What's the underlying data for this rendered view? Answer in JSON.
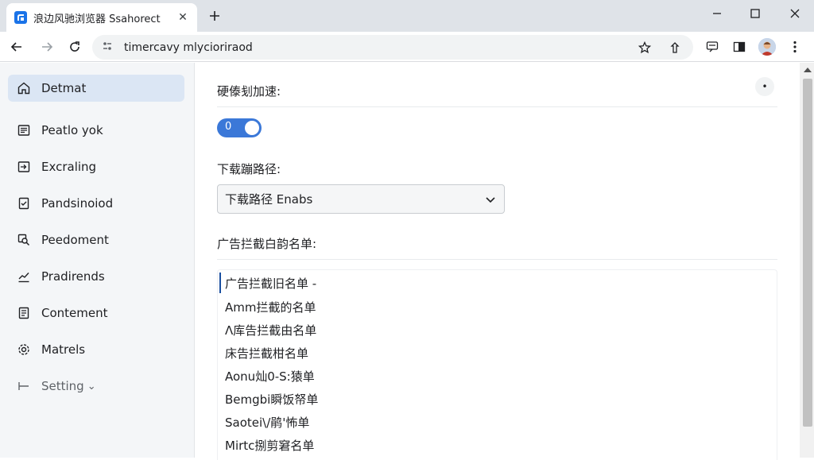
{
  "browser": {
    "tab": {
      "title": "浪边风驰浏览器 Ssahorect",
      "favicon_icon": "browser-logo-icon",
      "close_symbol": "✕"
    },
    "omnibox": {
      "url": "timercavy mlycioriraod"
    },
    "window_controls": [
      "minimize-icon",
      "maximize-icon",
      "close-icon"
    ]
  },
  "sidebar": {
    "items": [
      {
        "label": "Detmat",
        "icon": "home-icon",
        "active": true
      },
      {
        "label": "Peatlo yok",
        "icon": "document-icon"
      },
      {
        "label": "Excraling",
        "icon": "import-icon"
      },
      {
        "label": "Pandsinoiod",
        "icon": "checklist-icon"
      },
      {
        "label": "Peedoment",
        "icon": "search-icon"
      },
      {
        "label": "Pradirends",
        "icon": "trend-icon"
      },
      {
        "label": "Contement",
        "icon": "content-icon"
      },
      {
        "label": "Matrels",
        "icon": "gear-icon"
      },
      {
        "label": "Setting",
        "icon": "collapse-icon",
        "suffix": "⌄"
      }
    ]
  },
  "content": {
    "hardware_accel": {
      "title": "硬傣刬加速:",
      "toggle_text": "0",
      "enabled": true
    },
    "download_path": {
      "title": "下载蹦路径:",
      "selected": "下载路径 Enabs"
    },
    "adblock_whitelist": {
      "title": "广告拦截白韵名单:",
      "items": [
        "广告拦截旧名单 -",
        "Amm拦截的名单",
        "Λ库告拦截由名单",
        "床告拦截柑名单",
        "Aonu灿0-S:猿单",
        "Bemgbi瞬饭帑单",
        "Saotei\\/鹃'怖单",
        "Mirtc捌剪窘名单"
      ]
    },
    "more_symbol": "•"
  },
  "colors": {
    "accent": "#3b78d8",
    "active_nav": "#dbe6f4",
    "tabstrip": "#dfe3e8"
  }
}
